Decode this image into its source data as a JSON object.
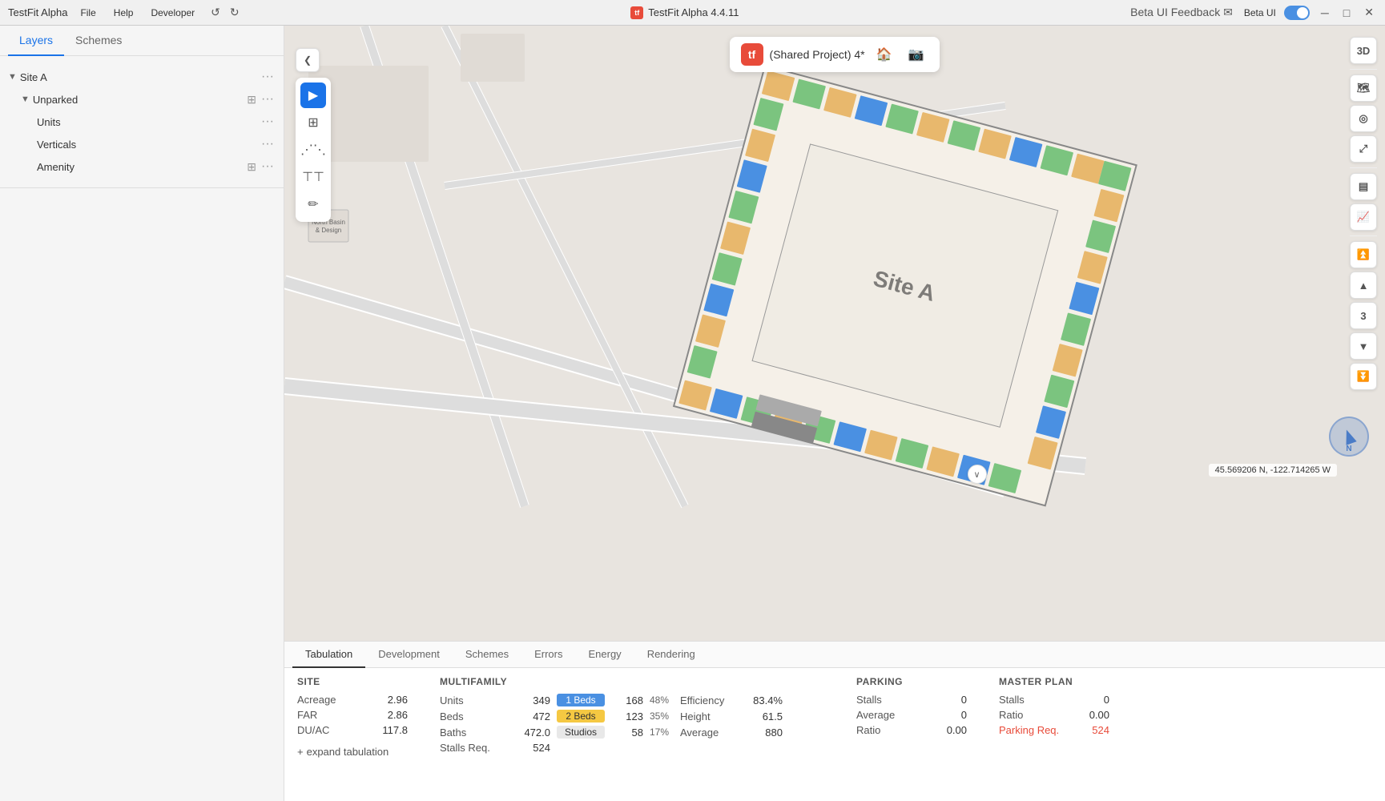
{
  "titlebar": {
    "app_name": "TestFit Alpha",
    "menu_items": [
      "File",
      "Help",
      "Developer"
    ],
    "center_label": "TestFit Alpha 4.4.11",
    "beta_feedback_label": "Beta UI Feedback",
    "beta_ui_label": "Beta UI",
    "undo_icon": "↺",
    "redo_icon": "↻"
  },
  "left_panel": {
    "tab_layers": "Layers",
    "tab_schemes": "Schemes",
    "site_a_label": "Site A",
    "unparked_label": "Unparked",
    "units_label": "Units",
    "verticals_label": "Verticals",
    "amenity_label": "Amenity"
  },
  "project_bar": {
    "name": "(Shared Project) 4*",
    "home_icon": "🏠",
    "camera_icon": "📷",
    "back_icon": "❮"
  },
  "tools": {
    "select": "▶",
    "building": "⊞",
    "path": "⋯",
    "fence": "⊤",
    "measure": "✏"
  },
  "right_tools": {
    "view_3d": "3D",
    "map_icon": "🗺",
    "location_icon": "◎",
    "expand_icon": "⤢",
    "layers_icon": "▤",
    "chart_icon": "▤",
    "up_double": "⏫",
    "up_single": "▲",
    "floor_num": "3",
    "down_single": "▼",
    "down_double": "⏬"
  },
  "map": {
    "site_label": "Site A",
    "coords": "45.569206 N, -122.714265 W"
  },
  "bottom_panel": {
    "tabs": [
      "Tabulation",
      "Development",
      "Schemes",
      "Errors",
      "Energy",
      "Rendering"
    ],
    "active_tab": "Tabulation",
    "site": {
      "title": "SITE",
      "rows": [
        {
          "label": "Acreage",
          "value": "2.96"
        },
        {
          "label": "FAR",
          "value": "2.86"
        },
        {
          "label": "DU/AC",
          "value": "117.8"
        }
      ]
    },
    "multifamily": {
      "title": "MULTIFAMILY",
      "rows": [
        {
          "label": "Units",
          "value": "349",
          "badge": "1 Beds",
          "badge_style": "blue",
          "count": "168",
          "pct": "48%",
          "sub": "Efficiency",
          "sub_val": "83.4%"
        },
        {
          "label": "Beds",
          "value": "472",
          "badge": "2 Beds",
          "badge_style": "yellow",
          "count": "123",
          "pct": "35%",
          "sub": "Height",
          "sub_val": "61.5"
        },
        {
          "label": "Baths",
          "value": "472.0",
          "badge": "Studios",
          "badge_style": "light",
          "count": "58",
          "pct": "17%",
          "sub": "Average",
          "sub_val": "880"
        },
        {
          "label": "Stalls Req.",
          "value": "524"
        }
      ]
    },
    "parking": {
      "title": "PARKING",
      "rows": [
        {
          "label": "Stalls",
          "value": "0"
        },
        {
          "label": "Average",
          "value": "0"
        },
        {
          "label": "Ratio",
          "value": "0.00"
        }
      ]
    },
    "master_plan": {
      "title": "MASTER PLAN",
      "rows": [
        {
          "label": "Stalls",
          "value": "0"
        },
        {
          "label": "Ratio",
          "value": "0.00"
        },
        {
          "label": "Parking Req.",
          "value": "524",
          "is_red": true
        }
      ]
    },
    "expand_label": "expand tabulation"
  }
}
